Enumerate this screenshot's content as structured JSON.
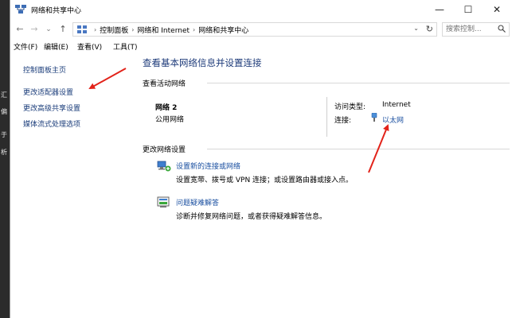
{
  "window": {
    "title": "网络和共享中心",
    "controls": {
      "minimize": "—",
      "maximize": "☐",
      "close": "✕"
    }
  },
  "nav": {
    "back": "←",
    "forward": "→",
    "recent": "⌄",
    "up": "↑"
  },
  "address": {
    "crumbs": [
      "控制面板",
      "网络和 Internet",
      "网络和共享中心"
    ],
    "separator": "›",
    "dropdown": "⌄",
    "refresh": "↻"
  },
  "search": {
    "placeholder": "搜索控制..."
  },
  "menu": {
    "file": "文件(F)",
    "edit": "编辑(E)",
    "view": "查看(V)",
    "tools": "工具(T)"
  },
  "sidebar": {
    "items": [
      {
        "label": "控制面板主页"
      },
      {
        "label": "更改适配器设置"
      },
      {
        "label": "更改高级共享设置"
      },
      {
        "label": "媒体流式处理选项"
      }
    ]
  },
  "main": {
    "heading": "查看基本网络信息并设置连接",
    "active_networks_label": "查看活动网络",
    "network": {
      "name": "网络 2",
      "profile": "公用网络",
      "access_type_label": "访问类型:",
      "access_type_value": "Internet",
      "connections_label": "连接:",
      "connection_name": "以太网"
    },
    "change_settings_label": "更改网络设置",
    "tasks": [
      {
        "title": "设置新的连接或网络",
        "description": "设置宽带、拨号或 VPN 连接；或设置路由器或接入点。"
      },
      {
        "title": "问题疑难解答",
        "description": "诊断并修复网络问题，或者获得疑难解答信息。"
      }
    ]
  },
  "background": {
    "fragments": [
      "汇",
      "偏",
      "于",
      "析"
    ]
  },
  "colors": {
    "link": "#1a4fa0",
    "heading": "#1e3b7a",
    "annotation_arrow": "#e2231a"
  }
}
